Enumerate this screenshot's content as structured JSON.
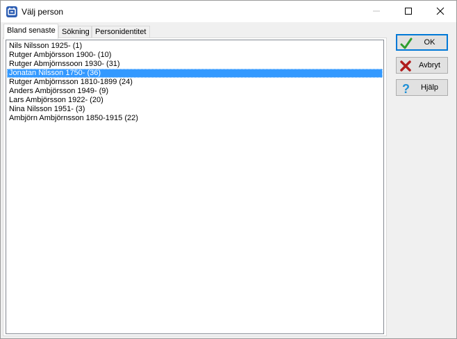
{
  "window": {
    "title": "Välj person"
  },
  "tabs": [
    {
      "label": "Bland senaste"
    },
    {
      "label": "Sökning"
    },
    {
      "label": "Personidentitet"
    }
  ],
  "persons": [
    "Nils Nilsson 1925- (1)",
    "Rutger Ambjörsson 1900- (10)",
    "Rutger Abmjörnssoon 1930- (31)",
    "Jonatan Nilsson 1750- (36)",
    "Rutger Ambjörnsson 1810-1899 (24)",
    "Anders Ambjörsson 1949- (9)",
    "Lars Ambjörsson 1922- (20)",
    "Nina Nilsson 1951- (3)",
    "Ambjörn Ambjörnsson 1850-1915 (22)"
  ],
  "selected_index": 3,
  "buttons": {
    "ok": "OK",
    "cancel": "Avbryt",
    "help": "Hjälp"
  },
  "icons": {
    "app": "app-logo-icon",
    "ok": "checkmark-icon",
    "cancel": "x-icon",
    "help": "question-mark-icon"
  },
  "colors": {
    "selection": "#3399ff",
    "default_button_border": "#0078d7",
    "check_green": "#2e9e2e",
    "cancel_red": "#b01c1c",
    "help_blue": "#1e90d6"
  }
}
